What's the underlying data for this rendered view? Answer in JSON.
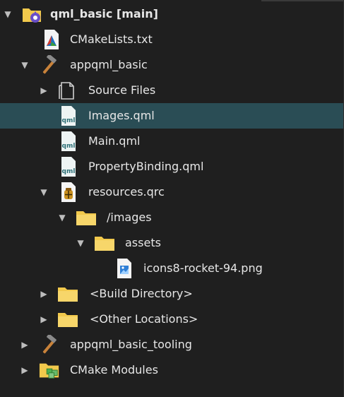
{
  "tree": {
    "root": {
      "label": "qml_basic [main]",
      "icon": "project-folder-gear-icon",
      "expanded": true
    },
    "cmakelists": {
      "label": "CMakeLists.txt",
      "icon": "cmake-file-icon"
    },
    "appqml_basic": {
      "label": "appqml_basic",
      "icon": "hammer-icon",
      "expanded": true
    },
    "source_files": {
      "label": "Source Files",
      "icon": "source-files-icon",
      "expanded": false
    },
    "images_qml": {
      "label": "Images.qml",
      "icon": "qml-file-icon",
      "selected": true,
      "badge": "qml"
    },
    "main_qml": {
      "label": "Main.qml",
      "icon": "qml-file-icon",
      "badge": "qml"
    },
    "propertybinding_qml": {
      "label": "PropertyBinding.qml",
      "icon": "qml-file-icon",
      "badge": "qml"
    },
    "resources_qrc": {
      "label": "resources.qrc",
      "icon": "resource-file-icon",
      "expanded": true
    },
    "images_prefix": {
      "label": "/images",
      "icon": "folder-icon",
      "expanded": true
    },
    "assets_folder": {
      "label": "assets",
      "icon": "folder-icon",
      "expanded": true
    },
    "rocket_png": {
      "label": "icons8-rocket-94.png",
      "icon": "image-file-icon"
    },
    "build_directory": {
      "label": "<Build Directory>",
      "icon": "folder-icon",
      "expanded": false
    },
    "other_locations": {
      "label": "<Other Locations>",
      "icon": "folder-icon",
      "expanded": false
    },
    "appqml_basic_tooling": {
      "label": "appqml_basic_tooling",
      "icon": "hammer-icon",
      "expanded": false
    },
    "cmake_modules": {
      "label": "CMake Modules",
      "icon": "modules-folder-icon",
      "expanded": false
    }
  },
  "colors": {
    "background": "#1f1f1f",
    "selection": "#2a4d55",
    "folder": "#f2c94c",
    "text": "#e7e7e7"
  }
}
